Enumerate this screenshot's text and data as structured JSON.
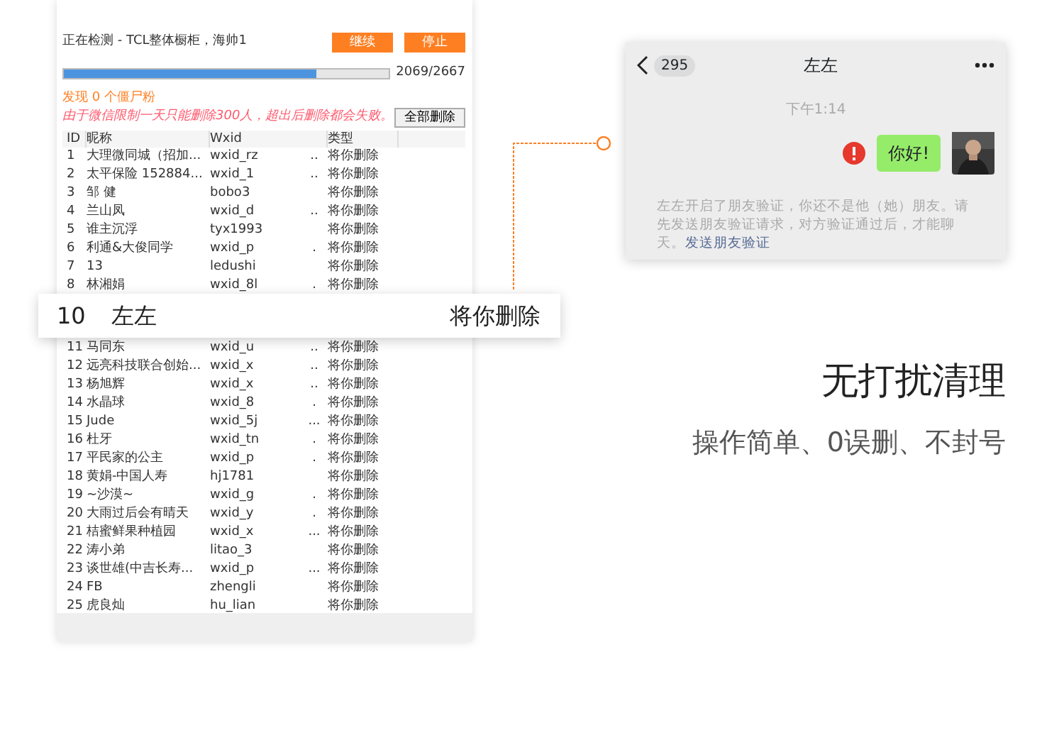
{
  "scan_panel": {
    "status": "正在检测 - TCL整体橱柜，海帅1",
    "buttons": [
      {
        "label": "继续"
      },
      {
        "label": "停止"
      }
    ],
    "progress": {
      "level": 0.776,
      "reading": "2069/2667"
    },
    "found": "发现 0 个僵尸粉",
    "warning": "由于微信限制一天只能删除300人，超出后删除都会失败。",
    "delete_all": "全部删除",
    "columns": [
      "ID",
      "昵称",
      "Wxid",
      "类型"
    ],
    "rows": [
      {
        "id": "1",
        "nickname": "大理微同城（招加...",
        "wxid": "wxid_rz",
        "mark": "..",
        "type": "将你删除"
      },
      {
        "id": "2",
        "nickname": "太平保险  152884...",
        "wxid": "wxid_1",
        "mark": "..",
        "type": "将你删除"
      },
      {
        "id": "3",
        "nickname": "邹 健",
        "wxid": "bobo3",
        "mark": "",
        "type": "将你删除"
      },
      {
        "id": "4",
        "nickname": "兰山凤",
        "wxid": "wxid_d",
        "mark": "..",
        "type": "将你删除"
      },
      {
        "id": "5",
        "nickname": "谁主沉浮",
        "wxid": "tyx1993",
        "mark": "",
        "type": "将你删除"
      },
      {
        "id": "6",
        "nickname": "利通&大俊同学",
        "wxid": "wxid_p",
        "mark": ".",
        "type": "将你删除"
      },
      {
        "id": "7",
        "nickname": "13",
        "wxid": "ledushi",
        "mark": "",
        "type": "将你删除"
      },
      {
        "id": "8",
        "nickname": "林湘娟",
        "wxid": "wxid_8l",
        "mark": ".",
        "type": "将你删除"
      },
      {
        "id": "11",
        "nickname": "马同东",
        "wxid": "wxid_u",
        "mark": "..",
        "type": "将你删除",
        "gap_before": true
      },
      {
        "id": "12",
        "nickname": "远亮科技联合创始...",
        "wxid": "wxid_x",
        "mark": "..",
        "type": "将你删除"
      },
      {
        "id": "13",
        "nickname": "杨旭辉",
        "wxid": "wxid_x",
        "mark": "..",
        "type": "将你删除"
      },
      {
        "id": "14",
        "nickname": "水晶球",
        "wxid": "wxid_8",
        "mark": ".",
        "type": "将你删除"
      },
      {
        "id": "15",
        "nickname": "Jude",
        "wxid": "wxid_5j",
        "mark": "...",
        "type": "将你删除"
      },
      {
        "id": "16",
        "nickname": "杜牙",
        "wxid": "wxid_tn",
        "mark": ".",
        "type": "将你删除"
      },
      {
        "id": "17",
        "nickname": "平民家的公主",
        "wxid": "wxid_p",
        "mark": ".",
        "type": "将你删除"
      },
      {
        "id": "18",
        "nickname": "黄娟-中国人寿",
        "wxid": "hj1781",
        "mark": "",
        "type": "将你删除"
      },
      {
        "id": "19",
        "nickname": "~沙漠~",
        "wxid": "wxid_g",
        "mark": ".",
        "type": "将你删除"
      },
      {
        "id": "20",
        "nickname": "大雨过后会有晴天",
        "wxid": "wxid_y",
        "mark": ".",
        "type": "将你删除"
      },
      {
        "id": "21",
        "nickname": "桔蜜鲜果种植园",
        "wxid": "wxid_x",
        "mark": "...",
        "type": "将你删除"
      },
      {
        "id": "22",
        "nickname": "涛小弟",
        "wxid": "litao_3",
        "mark": "",
        "type": "将你删除"
      },
      {
        "id": "23",
        "nickname": "谈世雄(中吉长寿...",
        "wxid": "wxid_p",
        "mark": "...",
        "type": "将你删除"
      },
      {
        "id": "24",
        "nickname": "FB",
        "wxid": "zhengli",
        "mark": "",
        "type": "将你删除"
      },
      {
        "id": "25",
        "nickname": "虎良灿",
        "wxid": "hu_lian",
        "mark": "",
        "type": "将你删除"
      }
    ]
  },
  "highlight_row": {
    "id": "10",
    "nickname": "左左",
    "type": "将你删除"
  },
  "chat": {
    "unread": "295",
    "title": "左左",
    "time": "下午1:14",
    "message": "你好!",
    "failed": true,
    "notice": "左左开启了朋友验证，你还不是他（她）朋友。请先发送朋友验证请求，对方验证通过后，才能聊天。",
    "notice_link": "发送朋友验证"
  },
  "headline": "无打扰清理",
  "subtitle": "操作简单、0误删、不封号"
}
